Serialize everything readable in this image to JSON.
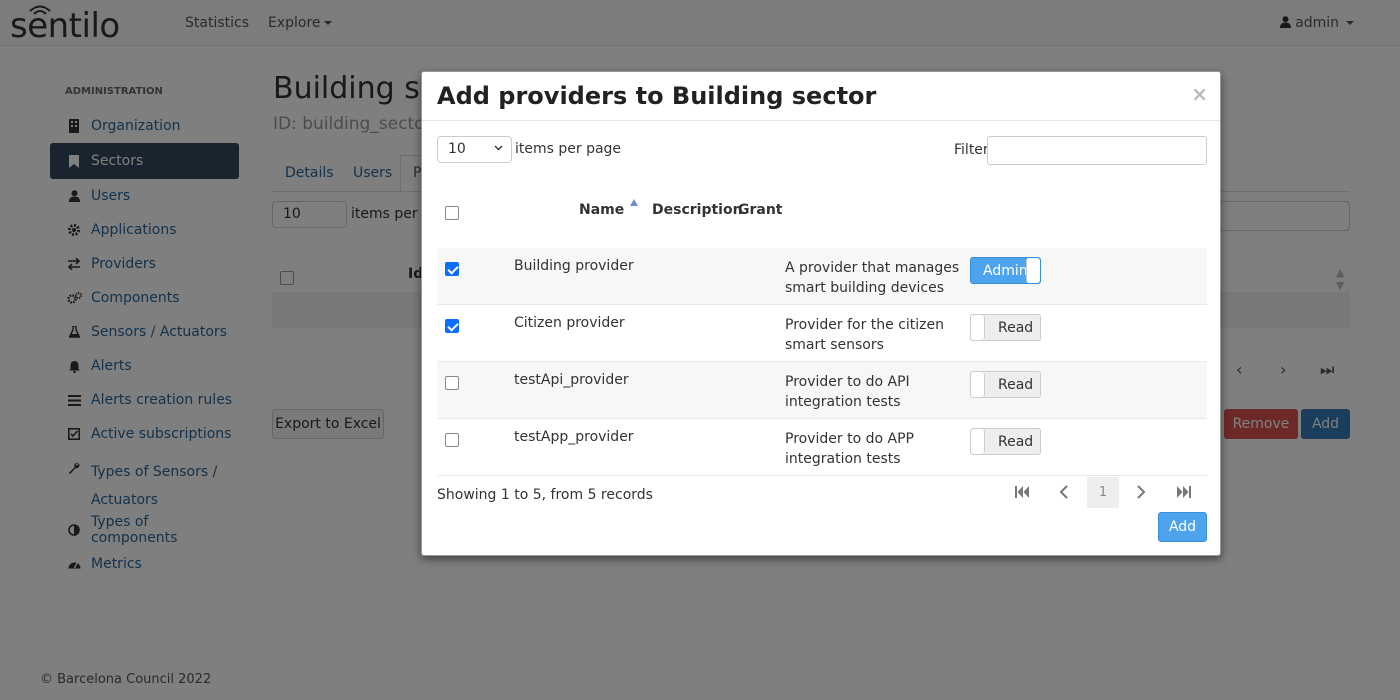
{
  "app": {
    "logo_text": "sentilo",
    "nav": {
      "statistics": "Statistics",
      "explore": "Explore",
      "user": "admin"
    }
  },
  "sidebar": {
    "heading": "ADMINISTRATION",
    "items": [
      {
        "label": "Organization",
        "icon": "building-icon"
      },
      {
        "label": "Sectors",
        "icon": "bookmark-icon",
        "active": true
      },
      {
        "label": "Users",
        "icon": "user-icon"
      },
      {
        "label": "Applications",
        "icon": "gear-icon"
      },
      {
        "label": "Providers",
        "icon": "exchange-icon"
      },
      {
        "label": "Components",
        "icon": "gears-icon"
      },
      {
        "label": "Sensors / Actuators",
        "icon": "flask-icon"
      },
      {
        "label": "Alerts",
        "icon": "bell-icon"
      },
      {
        "label": "Alerts creation rules",
        "icon": "list-icon"
      },
      {
        "label": "Active subscriptions",
        "icon": "checkbox-icon"
      },
      {
        "label": "Types of Sensors / Actuators",
        "icon": "wrench-icon"
      },
      {
        "label": "Types of components",
        "icon": "half-circle-icon"
      },
      {
        "label": "Metrics",
        "icon": "dashboard-icon"
      }
    ]
  },
  "page": {
    "title": "Building sec",
    "subtitle": "ID: building_sector",
    "tabs": [
      "Details",
      "Users",
      "P"
    ],
    "items_per_page_value": "10",
    "items_per_page_label": "items per pa",
    "table_col_id": "Id",
    "export_label": "Export to Excel",
    "remove_label": "Remove",
    "add_label": "Add"
  },
  "footer": "© Barcelona Council 2022",
  "modal": {
    "title": "Add providers to Building sector",
    "close": "×",
    "items_per_page_value": "10",
    "items_per_page_label": "items per page",
    "filter_label": "Filter",
    "filter_value": "",
    "columns": {
      "name": "Name",
      "description": "Description",
      "grant": "Grant"
    },
    "rows": [
      {
        "name": "Building provider",
        "description": "A provider that manages smart building devices",
        "grant": "Admin",
        "checked": true
      },
      {
        "name": "Citizen provider",
        "description": "Provider for the citizen smart sensors",
        "grant": "Read",
        "checked": true
      },
      {
        "name": "testApi_provider",
        "description": "Provider to do API integration tests",
        "grant": "Read",
        "checked": false
      },
      {
        "name": "testApp_provider",
        "description": "Provider to do APP integration tests",
        "grant": "Read",
        "checked": false
      }
    ],
    "showing": "Showing 1 to 5, from 5 records",
    "current_page": "1",
    "add_label": "Add"
  }
}
